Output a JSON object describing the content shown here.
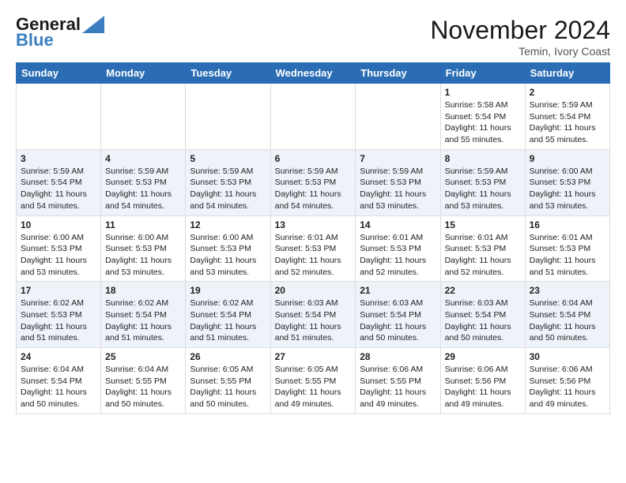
{
  "header": {
    "logo_line1": "General",
    "logo_line2": "Blue",
    "month_title": "November 2024",
    "location": "Temin, Ivory Coast"
  },
  "days_of_week": [
    "Sunday",
    "Monday",
    "Tuesday",
    "Wednesday",
    "Thursday",
    "Friday",
    "Saturday"
  ],
  "weeks": [
    [
      {
        "day": "",
        "info": ""
      },
      {
        "day": "",
        "info": ""
      },
      {
        "day": "",
        "info": ""
      },
      {
        "day": "",
        "info": ""
      },
      {
        "day": "",
        "info": ""
      },
      {
        "day": "1",
        "info": "Sunrise: 5:58 AM\nSunset: 5:54 PM\nDaylight: 11 hours and 55 minutes."
      },
      {
        "day": "2",
        "info": "Sunrise: 5:59 AM\nSunset: 5:54 PM\nDaylight: 11 hours and 55 minutes."
      }
    ],
    [
      {
        "day": "3",
        "info": "Sunrise: 5:59 AM\nSunset: 5:54 PM\nDaylight: 11 hours and 54 minutes."
      },
      {
        "day": "4",
        "info": "Sunrise: 5:59 AM\nSunset: 5:53 PM\nDaylight: 11 hours and 54 minutes."
      },
      {
        "day": "5",
        "info": "Sunrise: 5:59 AM\nSunset: 5:53 PM\nDaylight: 11 hours and 54 minutes."
      },
      {
        "day": "6",
        "info": "Sunrise: 5:59 AM\nSunset: 5:53 PM\nDaylight: 11 hours and 54 minutes."
      },
      {
        "day": "7",
        "info": "Sunrise: 5:59 AM\nSunset: 5:53 PM\nDaylight: 11 hours and 53 minutes."
      },
      {
        "day": "8",
        "info": "Sunrise: 5:59 AM\nSunset: 5:53 PM\nDaylight: 11 hours and 53 minutes."
      },
      {
        "day": "9",
        "info": "Sunrise: 6:00 AM\nSunset: 5:53 PM\nDaylight: 11 hours and 53 minutes."
      }
    ],
    [
      {
        "day": "10",
        "info": "Sunrise: 6:00 AM\nSunset: 5:53 PM\nDaylight: 11 hours and 53 minutes."
      },
      {
        "day": "11",
        "info": "Sunrise: 6:00 AM\nSunset: 5:53 PM\nDaylight: 11 hours and 53 minutes."
      },
      {
        "day": "12",
        "info": "Sunrise: 6:00 AM\nSunset: 5:53 PM\nDaylight: 11 hours and 53 minutes."
      },
      {
        "day": "13",
        "info": "Sunrise: 6:01 AM\nSunset: 5:53 PM\nDaylight: 11 hours and 52 minutes."
      },
      {
        "day": "14",
        "info": "Sunrise: 6:01 AM\nSunset: 5:53 PM\nDaylight: 11 hours and 52 minutes."
      },
      {
        "day": "15",
        "info": "Sunrise: 6:01 AM\nSunset: 5:53 PM\nDaylight: 11 hours and 52 minutes."
      },
      {
        "day": "16",
        "info": "Sunrise: 6:01 AM\nSunset: 5:53 PM\nDaylight: 11 hours and 51 minutes."
      }
    ],
    [
      {
        "day": "17",
        "info": "Sunrise: 6:02 AM\nSunset: 5:53 PM\nDaylight: 11 hours and 51 minutes."
      },
      {
        "day": "18",
        "info": "Sunrise: 6:02 AM\nSunset: 5:54 PM\nDaylight: 11 hours and 51 minutes."
      },
      {
        "day": "19",
        "info": "Sunrise: 6:02 AM\nSunset: 5:54 PM\nDaylight: 11 hours and 51 minutes."
      },
      {
        "day": "20",
        "info": "Sunrise: 6:03 AM\nSunset: 5:54 PM\nDaylight: 11 hours and 51 minutes."
      },
      {
        "day": "21",
        "info": "Sunrise: 6:03 AM\nSunset: 5:54 PM\nDaylight: 11 hours and 50 minutes."
      },
      {
        "day": "22",
        "info": "Sunrise: 6:03 AM\nSunset: 5:54 PM\nDaylight: 11 hours and 50 minutes."
      },
      {
        "day": "23",
        "info": "Sunrise: 6:04 AM\nSunset: 5:54 PM\nDaylight: 11 hours and 50 minutes."
      }
    ],
    [
      {
        "day": "24",
        "info": "Sunrise: 6:04 AM\nSunset: 5:54 PM\nDaylight: 11 hours and 50 minutes."
      },
      {
        "day": "25",
        "info": "Sunrise: 6:04 AM\nSunset: 5:55 PM\nDaylight: 11 hours and 50 minutes."
      },
      {
        "day": "26",
        "info": "Sunrise: 6:05 AM\nSunset: 5:55 PM\nDaylight: 11 hours and 50 minutes."
      },
      {
        "day": "27",
        "info": "Sunrise: 6:05 AM\nSunset: 5:55 PM\nDaylight: 11 hours and 49 minutes."
      },
      {
        "day": "28",
        "info": "Sunrise: 6:06 AM\nSunset: 5:55 PM\nDaylight: 11 hours and 49 minutes."
      },
      {
        "day": "29",
        "info": "Sunrise: 6:06 AM\nSunset: 5:56 PM\nDaylight: 11 hours and 49 minutes."
      },
      {
        "day": "30",
        "info": "Sunrise: 6:06 AM\nSunset: 5:56 PM\nDaylight: 11 hours and 49 minutes."
      }
    ]
  ]
}
